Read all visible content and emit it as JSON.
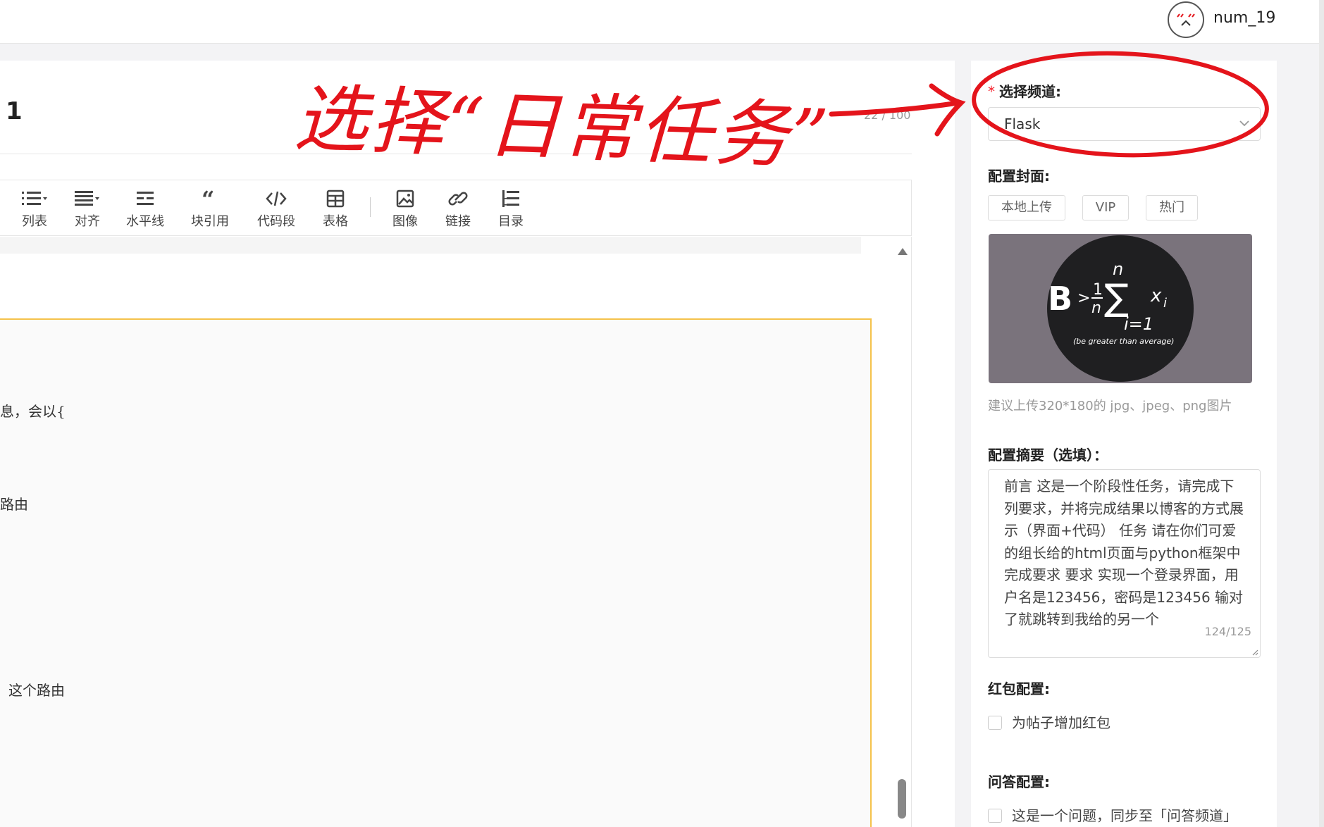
{
  "header": {
    "username": "num_19"
  },
  "editor": {
    "title": "1",
    "title_counter": "22 / 100",
    "toolbar": [
      {
        "label": "列表",
        "icon": "list-icon"
      },
      {
        "label": "对齐",
        "icon": "align-icon"
      },
      {
        "label": "水平线",
        "icon": "horizontal-rule-icon"
      },
      {
        "label": "块引用",
        "icon": "quote-icon"
      },
      {
        "label": "代码段",
        "icon": "code-icon"
      },
      {
        "label": "表格",
        "icon": "table-icon"
      },
      {
        "label": "图像",
        "icon": "image-icon"
      },
      {
        "label": "链接",
        "icon": "link-icon"
      },
      {
        "label": "目录",
        "icon": "toc-icon"
      }
    ],
    "content_lines": [
      "息，会以{",
      "路由",
      "这个路由"
    ]
  },
  "sidebar": {
    "channel_label": "选择频道:",
    "channel_value": "Flask",
    "cover_label": "配置封面:",
    "cover_buttons": [
      "本地上传",
      "VIP",
      "热门"
    ],
    "cover_image_text": {
      "formula_left": "B",
      "formula_gt": ">",
      "formula_top": "n",
      "formula_frac_num": "1",
      "formula_frac_den": "n",
      "formula_sum": "∑",
      "formula_var": "x",
      "formula_sub": "i",
      "formula_bottom": "i=1",
      "caption": "(be greater than average)"
    },
    "cover_hint": "建议上传320*180的 jpg、jpeg、png图片",
    "summary_label": "配置摘要（选填）：",
    "summary_text": "前言 这是一个阶段性任务，请完成下列要求，并将完成结果以博客的方式展示（界面+代码） 任务 请在你们可爱的组长给的html页面与python框架中完成要求 要求 实现一个登录界面，用户名是123456，密码是123456 输对了就跳转到我给的另一个",
    "summary_count": "124/125",
    "redpacket_label": "红包配置:",
    "redpacket_option": "为帖子增加红包",
    "qa_label": "问答配置:",
    "qa_option": "这是一个问题，同步至「问答频道」"
  },
  "annotation": {
    "text": "选择“日常任务”"
  },
  "colors": {
    "annotation_red": "#e4141b",
    "editor_highlight": "#f5c24b",
    "required": "#f5222d"
  }
}
